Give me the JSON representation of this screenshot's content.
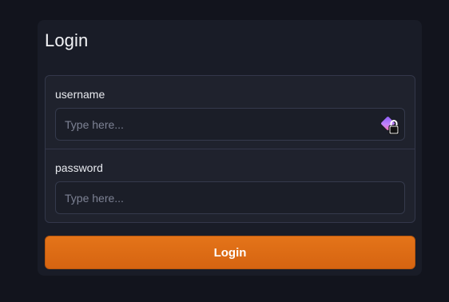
{
  "form": {
    "title": "Login",
    "username": {
      "label": "username",
      "placeholder": "Type here...",
      "value": ""
    },
    "password": {
      "label": "password",
      "placeholder": "Type here...",
      "value": ""
    },
    "submit_label": "Login",
    "password_manager_icon": "password-manager-lock-icon"
  },
  "colors": {
    "background": "#12141d",
    "card": "#191c27",
    "accent": "#e06d15"
  }
}
